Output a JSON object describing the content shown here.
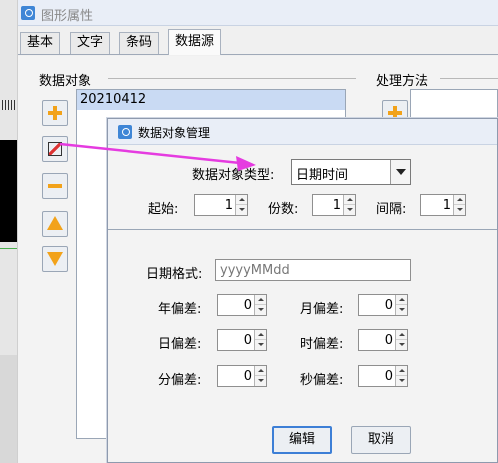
{
  "window": {
    "title": "图形属性"
  },
  "tabs": [
    {
      "label": "基本",
      "active": false
    },
    {
      "label": "文字",
      "active": false
    },
    {
      "label": "条码",
      "active": false
    },
    {
      "label": "数据源",
      "active": true
    }
  ],
  "data_source": {
    "objects_label": "数据对象",
    "items": [
      "20210412"
    ],
    "method_label": "处理方法"
  },
  "dialog": {
    "title": "数据对象管理",
    "type_label": "数据对象类型:",
    "type_value": "日期时间",
    "start_label": "起始:",
    "start_value": "1",
    "copies_label": "份数:",
    "copies_value": "1",
    "interval_label": "间隔:",
    "interval_value": "1",
    "format_label": "日期格式:",
    "format_value": "yyyyMMdd",
    "offsets": {
      "year_label": "年偏差:",
      "year_value": "0",
      "month_label": "月偏差:",
      "month_value": "0",
      "day_label": "日偏差:",
      "day_value": "0",
      "hour_label": "时偏差:",
      "hour_value": "0",
      "minute_label": "分偏差:",
      "minute_value": "0",
      "second_label": "秒偏差:",
      "second_value": "0"
    },
    "edit_button": "编辑",
    "cancel_button": "取消"
  },
  "colors": {
    "accent": "#f2a21a",
    "annotation_arrow": "#e53be0",
    "selection": "#c9daf3"
  }
}
